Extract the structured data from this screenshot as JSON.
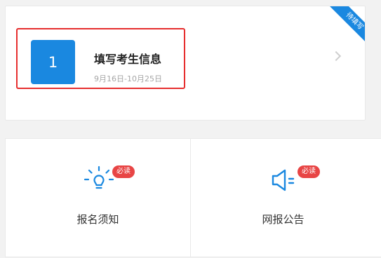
{
  "step": {
    "number": "1",
    "title": "填写考生信息",
    "date": "9月16日-10月25日",
    "status": "待填写",
    "accent_color": "#1a88e0",
    "highlight_color": "#e62e2e"
  },
  "grid": {
    "items": [
      {
        "label": "报名须知",
        "badge": "必读",
        "icon": "lightbulb-icon"
      },
      {
        "label": "网报公告",
        "badge": "必读",
        "icon": "speaker-icon"
      }
    ],
    "badge_color": "#e84545"
  }
}
